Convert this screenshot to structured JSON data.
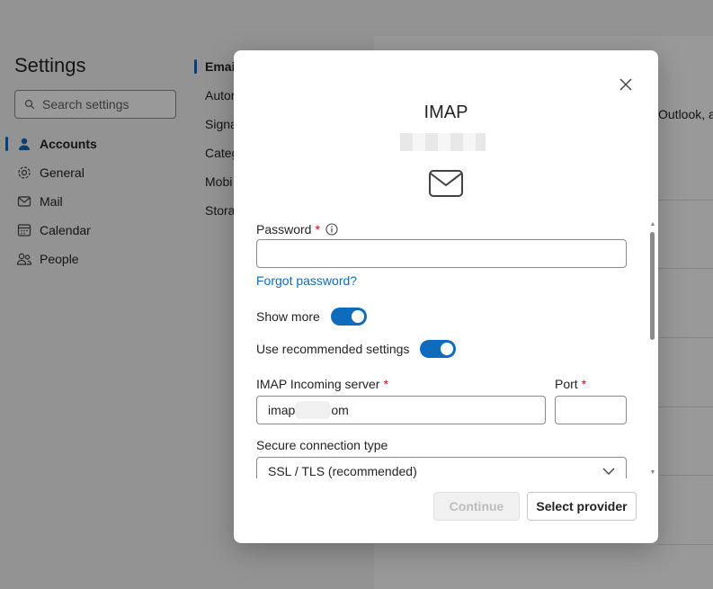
{
  "background": {
    "settings_title": "Settings",
    "search_placeholder": "Search settings",
    "nav": [
      {
        "label": "Accounts",
        "icon": "person-icon",
        "active": true
      },
      {
        "label": "General",
        "icon": "gear-icon",
        "active": false
      },
      {
        "label": "Mail",
        "icon": "mail-icon",
        "active": false
      },
      {
        "label": "Calendar",
        "icon": "calendar-icon",
        "active": false
      },
      {
        "label": "People",
        "icon": "people-icon",
        "active": false
      }
    ],
    "subnav": [
      "Emai",
      "Autor",
      "Signa",
      "Categ",
      "Mobi",
      "Stora"
    ],
    "content_text": "Outlook, a"
  },
  "dialog": {
    "title": "IMAP",
    "email": "",
    "icon": "envelope-icon",
    "password": {
      "label": "Password",
      "value": ""
    },
    "forgot_password": "Forgot password?",
    "show_more": {
      "label": "Show more",
      "on": true
    },
    "recommended": {
      "label": "Use recommended settings",
      "on": true
    },
    "incoming_server": {
      "label": "IMAP Incoming server",
      "value_prefix": "imap",
      "value_suffix": "om"
    },
    "port": {
      "label": "Port",
      "value": ""
    },
    "secure_connection": {
      "label": "Secure connection type",
      "value": "SSL / TLS (recommended)"
    },
    "continue_label": "Continue",
    "select_provider_label": "Select provider",
    "accent": "#0f6cbd",
    "required_color": "#c50f1f"
  }
}
